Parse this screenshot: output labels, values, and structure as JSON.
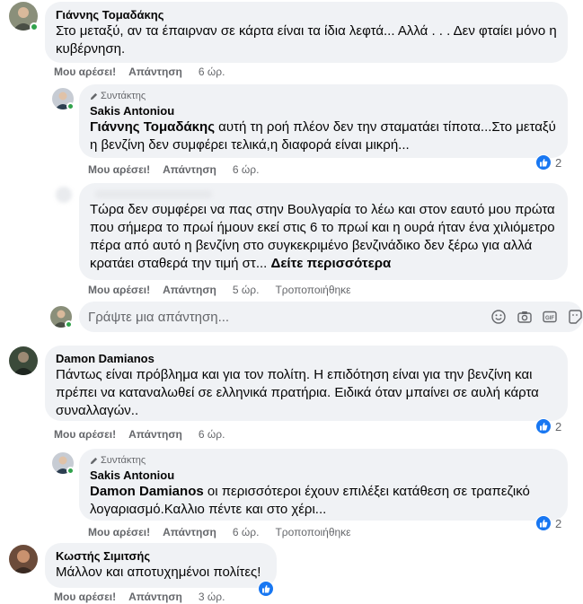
{
  "actions": {
    "like": "Μου αρέσει!",
    "reply": "Απάντηση",
    "edited": "Τροποποιήθηκε",
    "see_more": "Δείτε περισσότερα"
  },
  "author_badge": "Συντάκτης",
  "comments": [
    {
      "name": "Γιάννης Τομαδάκης",
      "text": "Στο μεταξύ, αν τα έπαιρναν σε κάρτα είναι τα ίδια λεφτά... Αλλά . . . Δεν φταίει μόνο η κυβέρνηση.",
      "time": "6 ώρ."
    },
    {
      "name": "Sakis Antoniou",
      "mention": "Γιάννης Τομαδάκης",
      "text": " αυτή τη ροή πλέον δεν την σταματάει τίποτα...Στο μεταξύ η βενζίνη δεν συμφέρει τελικά,η διαφορά είναι μικρή...",
      "time": "6 ώρ.",
      "reactions": "2"
    },
    {
      "text": "Τώρα δεν συμφέρει να πας στην Βουλγαρία το λέω και στον εαυτό μου πρώτα που σήμερα το πρωί ήμουν εκεί στις 6 το πρωί και η ουρά ήταν ένα χιλιόμετρο πέρα από αυτό η βενζίνη στο συγκεκριμένο βενζινάδικο δεν ξέρω για αλλά κρατάει σταθερά την τιμή στ... ",
      "time": "5 ώρ."
    },
    {
      "name": "Damon Damianos",
      "text": "Πάντως είναι πρόβλημα και για τον πολίτη. Η επιδότηση είναι για την βενζίνη και πρέπει να καταναλωθεί σε ελληνικά πρατήρια. Ειδικά όταν μπαίνει σε αυλή κάρτα συναλλαγών..",
      "time": "6 ώρ.",
      "reactions": "2"
    },
    {
      "name": "Sakis Antoniou",
      "mention": "Damon Damianos",
      "text": " οι περισσότεροι έχουν επιλέξει κατάθεση σε τραπεζικό λογαριασμό.Καλλιο πέντε και στο χέρι...",
      "time": "6 ώρ.",
      "reactions": "2"
    },
    {
      "name": "Κωστής Σιμιτσής",
      "text": "Μάλλον και αποτυχημένοι πολίτες!",
      "time": "3 ώρ."
    }
  ],
  "reply_box": {
    "placeholder": "Γράψτε μια απάντηση..."
  },
  "colors": {
    "bubble": "#f0f2f5",
    "accent": "#1877f2",
    "meta": "#65676b",
    "online": "#31a24c"
  },
  "icons": [
    "emoji-icon",
    "camera-icon",
    "gif-icon",
    "sticker-icon",
    "like-reaction-icon",
    "pencil-icon"
  ]
}
